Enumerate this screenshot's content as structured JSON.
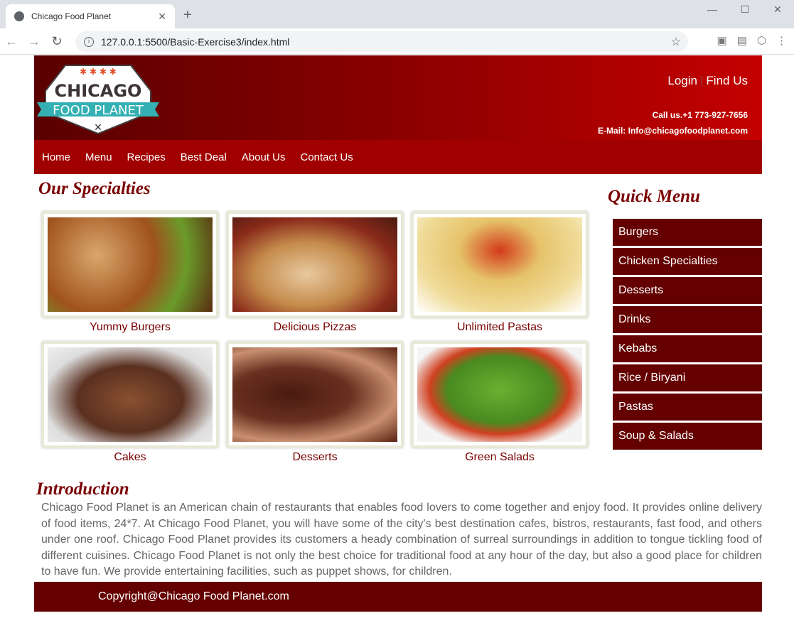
{
  "browser": {
    "tab_title": "Chicago Food Planet",
    "url": "127.0.0.1:5500/Basic-Exercise3/index.html"
  },
  "header": {
    "logo_text": "CHICAGO FOOD PLANET",
    "login": "Login",
    "separator": "|",
    "find_us": "Find Us",
    "phone": "Call us.+1 773-927-7656",
    "email": "E-Mail: Info@chicagofoodplanet.com"
  },
  "nav": [
    "Home",
    "Menu",
    "Recipes",
    "Best Deal",
    "About Us",
    "Contact Us"
  ],
  "specialties": {
    "title": "Our Specialties",
    "items": [
      "Yummy Burgers",
      "Delicious Pizzas",
      "Unlimited Pastas",
      "Cakes",
      "Desserts",
      "Green Salads"
    ]
  },
  "quick_menu": {
    "title": "Quick Menu",
    "items": [
      "Burgers",
      "Chicken Specialties",
      "Desserts",
      "Drinks",
      "Kebabs",
      "Rice / Biryani",
      "Pastas",
      "Soup & Salads"
    ]
  },
  "intro": {
    "title": "Introduction",
    "text": "Chicago Food Planet is an American chain of restaurants that enables food lovers to come together and enjoy food. It provides online delivery of food items, 24*7. At Chicago Food Planet, you will have some of the city's best destination cafes, bistros, restaurants, fast food, and others under one roof. Chicago Food Planet provides its customers a heady combination of surreal surroundings in addition to tongue tickling food of different cuisines. Chicago Food Planet is not only the best choice for traditional food at any hour of the day, but also a good place for children to have fun. We provide entertaining facilities, such as puppet shows, for children."
  },
  "footer": {
    "text": "Copyright@Chicago Food Planet.com"
  }
}
